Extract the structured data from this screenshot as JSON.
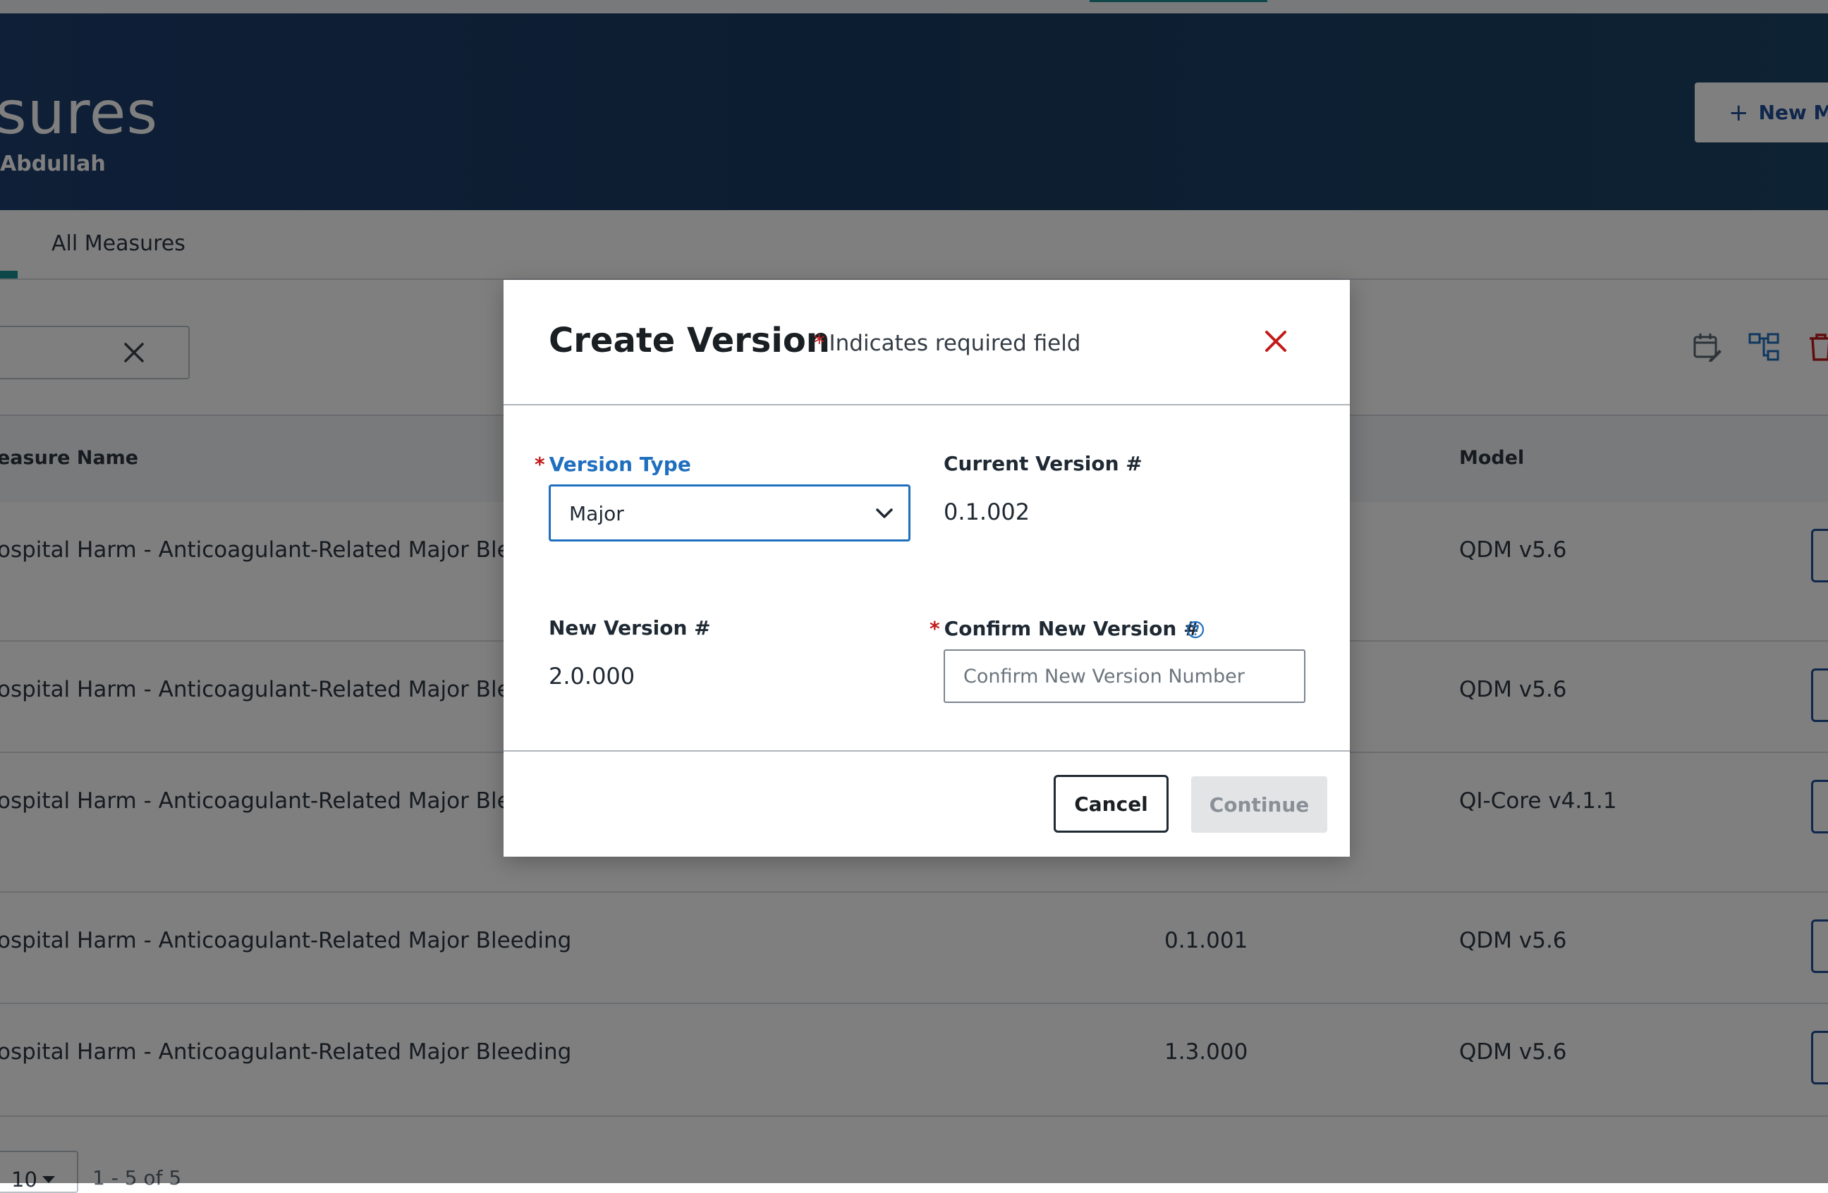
{
  "header": {
    "title": "sures",
    "user": "Abdullah",
    "new_button_label": "New Me"
  },
  "tabs": [
    {
      "label": "All Measures"
    }
  ],
  "table": {
    "columns": {
      "name": "easure Name",
      "model": "Model"
    },
    "rows": [
      {
        "name": "ospital Harm - Anticoagulant-Related Major Blee",
        "version": "",
        "model": "QDM v5.6"
      },
      {
        "name": "ospital Harm - Anticoagulant-Related Major Blee",
        "version": "",
        "model": "QDM v5.6"
      },
      {
        "name": "ospital Harm - Anticoagulant-Related Major Blee",
        "version": "",
        "model": "QI-Core v4.1.1"
      },
      {
        "name": "ospital Harm - Anticoagulant-Related Major Bleeding",
        "version": "0.1.001",
        "model": "QDM v5.6"
      },
      {
        "name": "ospital Harm - Anticoagulant-Related Major Bleeding",
        "version": "1.3.000",
        "model": "QDM v5.6"
      }
    ]
  },
  "pagination": {
    "page_size": "10",
    "range": "1 - 5 of 5"
  },
  "modal": {
    "title": "Create Version",
    "required_note": "Indicates required field",
    "required_marker": "*",
    "version_type": {
      "label": "Version Type",
      "value": "Major"
    },
    "current_version": {
      "label": "Current Version #",
      "value": "0.1.002"
    },
    "new_version": {
      "label": "New Version #",
      "value": "2.0.000"
    },
    "confirm_version": {
      "label": "Confirm New Version #",
      "placeholder": "Confirm New Version Number",
      "value": ""
    },
    "cancel_label": "Cancel",
    "continue_label": "Continue"
  },
  "icons": {
    "close": "close-icon",
    "chevron": "chevron-down-icon",
    "help": "help-icon",
    "calendar_edit": "calendar-edit-icon",
    "hierarchy": "hierarchy-icon",
    "trash": "trash-icon"
  },
  "colors": {
    "banner": "#1d3e6e",
    "accent": "#1f6fbf",
    "danger": "#c21a1a",
    "teal": "#1a8f95"
  }
}
